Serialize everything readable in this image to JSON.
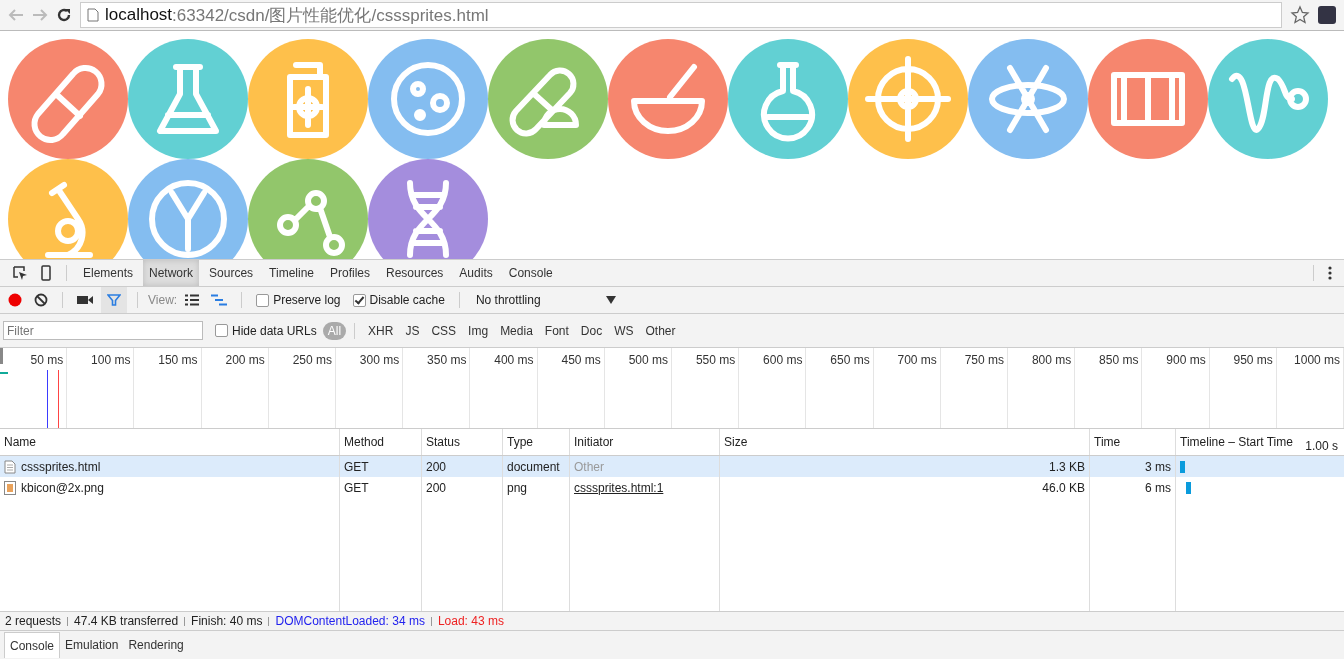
{
  "address_bar": {
    "host": "localhost",
    "path": ":63342/csdn/图片性能优化/csssprites.html"
  },
  "sprites": [
    {
      "color": "#f6866e"
    },
    {
      "color": "#62d0d3"
    },
    {
      "color": "#fec04b"
    },
    {
      "color": "#84bdf0"
    },
    {
      "color": "#92c66b"
    },
    {
      "color": "#f6866e"
    },
    {
      "color": "#62d0d3"
    },
    {
      "color": "#fec04b"
    },
    {
      "color": "#84bdf0"
    },
    {
      "color": "#f6866e"
    },
    {
      "color": "#62d0d3"
    },
    {
      "color": "#fec04b"
    },
    {
      "color": "#84bdf0"
    },
    {
      "color": "#92c66b"
    },
    {
      "color": "#a48ddd"
    }
  ],
  "devtools_tabs": [
    {
      "label": "Elements",
      "selected": false
    },
    {
      "label": "Network",
      "selected": true
    },
    {
      "label": "Sources",
      "selected": false
    },
    {
      "label": "Timeline",
      "selected": false
    },
    {
      "label": "Profiles",
      "selected": false
    },
    {
      "label": "Resources",
      "selected": false
    },
    {
      "label": "Audits",
      "selected": false
    },
    {
      "label": "Console",
      "selected": false
    }
  ],
  "toolbar": {
    "recording": true,
    "filter_on": true,
    "view_label": "View:",
    "preserve_log": {
      "label": "Preserve log",
      "checked": false
    },
    "disable_cache": {
      "label": "Disable cache",
      "checked": true
    },
    "throttling": "No throttling"
  },
  "filter_bar": {
    "placeholder": "Filter",
    "hide_data_urls": {
      "label": "Hide data URLs",
      "checked": false
    },
    "types": [
      {
        "label": "All",
        "selected": true
      },
      {
        "label": "XHR",
        "selected": false
      },
      {
        "label": "JS",
        "selected": false
      },
      {
        "label": "CSS",
        "selected": false
      },
      {
        "label": "Img",
        "selected": false
      },
      {
        "label": "Media",
        "selected": false
      },
      {
        "label": "Font",
        "selected": false
      },
      {
        "label": "Doc",
        "selected": false
      },
      {
        "label": "WS",
        "selected": false
      },
      {
        "label": "Other",
        "selected": false
      }
    ]
  },
  "overview_ticks": [
    "50 ms",
    "100 ms",
    "150 ms",
    "200 ms",
    "250 ms",
    "300 ms",
    "350 ms",
    "400 ms",
    "450 ms",
    "500 ms",
    "550 ms",
    "600 ms",
    "650 ms",
    "700 ms",
    "750 ms",
    "800 ms",
    "850 ms",
    "900 ms",
    "950 ms",
    "1000 ms"
  ],
  "table": {
    "columns": [
      "Name",
      "Method",
      "Status",
      "Type",
      "Initiator",
      "Size",
      "Time",
      "Timeline – Start Time"
    ],
    "scale": "1.00 s",
    "rows": [
      {
        "kind": "document",
        "selected": true,
        "name": "csssprites.html",
        "method": "GET",
        "status": "200",
        "type": "document",
        "initiator": "Other",
        "initiator_link": false,
        "size": "1.3 KB",
        "time": "3 ms"
      },
      {
        "kind": "image",
        "selected": false,
        "name": "kbicon@2x.png",
        "method": "GET",
        "status": "200",
        "type": "png",
        "initiator": "csssprites.html:1",
        "initiator_link": true,
        "size": "46.0 KB",
        "time": "6 ms"
      }
    ]
  },
  "status_bar": [
    {
      "kind": "plain",
      "text": "2 requests"
    },
    {
      "kind": "plain",
      "text": "47.4 KB transferred"
    },
    {
      "kind": "plain",
      "text": "Finish: 40 ms"
    },
    {
      "kind": "dom",
      "text": "DOMContentLoaded: 34 ms"
    },
    {
      "kind": "load",
      "text": "Load: 43 ms"
    }
  ],
  "drawer_tabs": [
    {
      "label": "Console",
      "selected": true
    },
    {
      "label": "Emulation",
      "selected": false
    },
    {
      "label": "Rendering",
      "selected": false
    }
  ]
}
